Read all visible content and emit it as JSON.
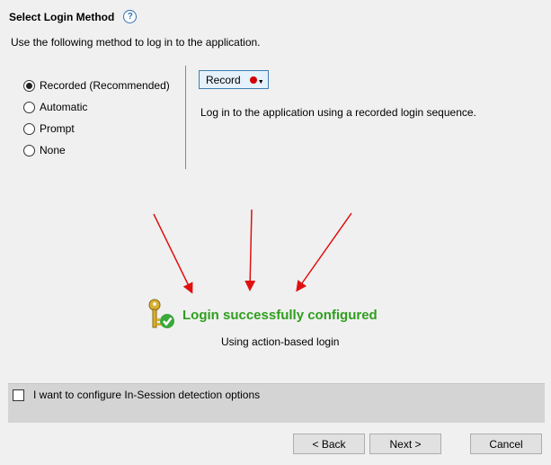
{
  "header": {
    "title": "Select Login Method",
    "help_icon": "?",
    "description": "Use the following method to log in to the application."
  },
  "methods": [
    {
      "label": "Recorded (Recommended)",
      "selected": true
    },
    {
      "label": "Automatic",
      "selected": false
    },
    {
      "label": "Prompt",
      "selected": false
    },
    {
      "label": "None",
      "selected": false
    }
  ],
  "record": {
    "button_label": "Record",
    "description": "Log in to the application using a recorded login sequence."
  },
  "status": {
    "title": "Login successfully configured",
    "subtitle": "Using action-based login",
    "color": "#2f9e1e"
  },
  "options": {
    "insession_label": "I want to configure In-Session detection options",
    "insession_checked": false
  },
  "footer": {
    "back_label": "< Back",
    "next_label": "Next >",
    "cancel_label": "Cancel"
  }
}
